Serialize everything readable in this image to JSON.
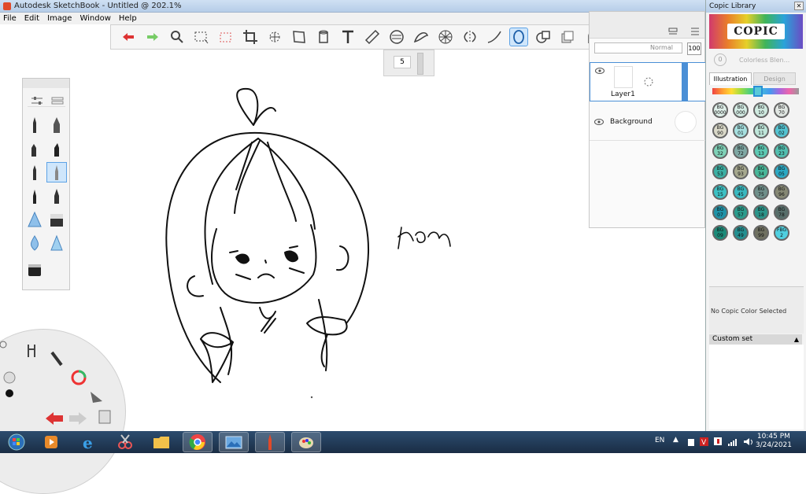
{
  "window": {
    "title": "Autodesk SketchBook - Untitled @ 202.1%"
  },
  "menu": [
    "File",
    "Edit",
    "Image",
    "Window",
    "Help"
  ],
  "brush": {
    "size": "5"
  },
  "layers": {
    "blend_mode": "Normal",
    "opacity": "100",
    "items": [
      {
        "name": "Layer1",
        "selected": true
      },
      {
        "name": "Background",
        "selected": false
      }
    ]
  },
  "copic": {
    "title": "Copic Library",
    "logo": "COPIC",
    "colorless": "Colorless Blen...",
    "colorless_code": "0",
    "tabs": [
      "Illustration",
      "Design"
    ],
    "swatches": [
      {
        "code": "BG 0000",
        "color": "#dff0ea"
      },
      {
        "code": "BG 000",
        "color": "#d3ece4"
      },
      {
        "code": "BG 10",
        "color": "#cfeae0"
      },
      {
        "code": "BG 70",
        "color": "#e0e6e2"
      },
      {
        "code": "BG 90",
        "color": "#d9d8c8"
      },
      {
        "code": "BG 01",
        "color": "#a6e0e0"
      },
      {
        "code": "BG 11",
        "color": "#bfe6da"
      },
      {
        "code": "BG 02",
        "color": "#53c4d2"
      },
      {
        "code": "BG 32",
        "color": "#7fd2b8"
      },
      {
        "code": "BG 72",
        "color": "#7fa8a4"
      },
      {
        "code": "BG 13",
        "color": "#5ccab4"
      },
      {
        "code": "BG 23",
        "color": "#51bfb0"
      },
      {
        "code": "BG 53",
        "color": "#3bb0a4"
      },
      {
        "code": "BG 93",
        "color": "#a6a88e"
      },
      {
        "code": "BG 34",
        "color": "#48b89a"
      },
      {
        "code": "BG 05",
        "color": "#2aa9c4"
      },
      {
        "code": "BG 15",
        "color": "#3cc1c4"
      },
      {
        "code": "BG 45",
        "color": "#39b9c0"
      },
      {
        "code": "BG 75",
        "color": "#6f8f8a"
      },
      {
        "code": "BG 96",
        "color": "#868874"
      },
      {
        "code": "BG 07",
        "color": "#1e93a8"
      },
      {
        "code": "BG 57",
        "color": "#2a9c8c"
      },
      {
        "code": "BG 18",
        "color": "#2a958a"
      },
      {
        "code": "BG 78",
        "color": "#576e6a"
      },
      {
        "code": "BG 09",
        "color": "#1a8a78"
      },
      {
        "code": "BG 49",
        "color": "#238f90"
      },
      {
        "code": "BG 99",
        "color": "#6f7060"
      },
      {
        "code": "FBG 2",
        "color": "#4fd0e0"
      }
    ],
    "no_selection": "No Copic Color Selected",
    "custom_set": "Custom set"
  },
  "canvas": {
    "signature": "Ham"
  },
  "taskbar": {
    "language": "EN",
    "time": "10:45 PM",
    "date": "3/24/2021"
  },
  "colors": {
    "selection": "#5ea3e6",
    "selection_fill": "#cfe6fb",
    "taskbar": "#1a2d45"
  }
}
